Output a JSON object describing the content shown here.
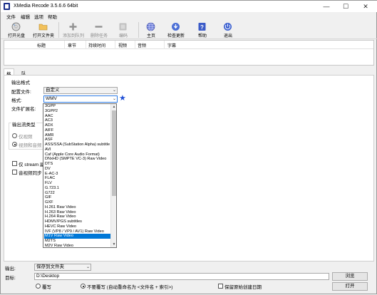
{
  "window": {
    "title": "XMedia Recode 3.5.6.6 64bit",
    "controls": {
      "minimize": "—",
      "maximize": "☐",
      "close": "✕"
    }
  },
  "menu": [
    "文件",
    "编辑",
    "选项",
    "帮助"
  ],
  "toolbar": {
    "buttons": [
      {
        "label": "打开光盘",
        "icon": "disc-icon",
        "enabled": true
      },
      {
        "label": "打开文件夹",
        "icon": "folder-open-icon",
        "enabled": true
      },
      {
        "label": "添加到队列",
        "icon": "add-to-queue-icon",
        "enabled": false
      },
      {
        "label": "删除任务",
        "icon": "delete-task-icon",
        "enabled": false
      },
      {
        "label": "编码",
        "icon": "encode-icon",
        "enabled": false
      },
      {
        "label": "主页",
        "icon": "globe-icon",
        "enabled": true
      },
      {
        "label": "检查更新",
        "icon": "update-icon",
        "enabled": true
      },
      {
        "label": "帮助",
        "icon": "help-icon",
        "enabled": true
      },
      {
        "label": "退出",
        "icon": "exit-icon",
        "enabled": true
      }
    ]
  },
  "joblist": {
    "columns": [
      "标题",
      "章节",
      "持续时间",
      "视频",
      "音频",
      "字幕"
    ]
  },
  "tabs": [
    {
      "label": "格式",
      "active": true
    },
    {
      "label": "队列",
      "active": false
    }
  ],
  "format_panel": {
    "section_title": "输出格式",
    "profile_label": "配置文件:",
    "profile_value": "自定义",
    "format_label": "格式:",
    "format_value": "WMV",
    "extension_label": "文件扩展名:",
    "output_stream_label": "输出流类型",
    "video_only_label": "仅视频",
    "video_audio_label": "视频和音频",
    "stream_copy_label": "仅 stream 副",
    "direct_sync_label": "音视频同步"
  },
  "format_dropdown": {
    "selected_index": 27,
    "options": [
      "3GPP",
      "3GPP2",
      "AAC",
      "AC3",
      "ADX",
      "AIFF",
      "AMR",
      "ASF",
      "ASS/SSA (SubStation Alpha) subtitle",
      "AVI",
      "Caf (Apple Core Audio Format)",
      "DNxHD (SMPTE VC-3) Raw Video",
      "DTS",
      "DV",
      "E-AC-3",
      "FLAC",
      "FLV",
      "G.723.1",
      "G722",
      "GIF",
      "GXF",
      "H.261 Raw Video",
      "H.263 Raw Video",
      "H.264 Raw Video",
      "HDMV/PGS subtitles",
      "HEVC Raw Video",
      "IVF (VP8 / VP9 / AV1) Raw Video",
      "M1V Raw Video",
      "M2TS",
      "M2V Raw Video"
    ]
  },
  "bottom": {
    "output_label": "输出:",
    "output_value": "保存到文件夹",
    "target_label": "目标:",
    "target_value": "D:\\Desktop",
    "browse_label": "浏览",
    "overwrite_label": "覆写",
    "no_overwrite_label": "不要覆写 (自动重命名为 <文件名 + 索引>)",
    "keep_date_label": "保留原始创建日期",
    "open_label": "打开"
  }
}
